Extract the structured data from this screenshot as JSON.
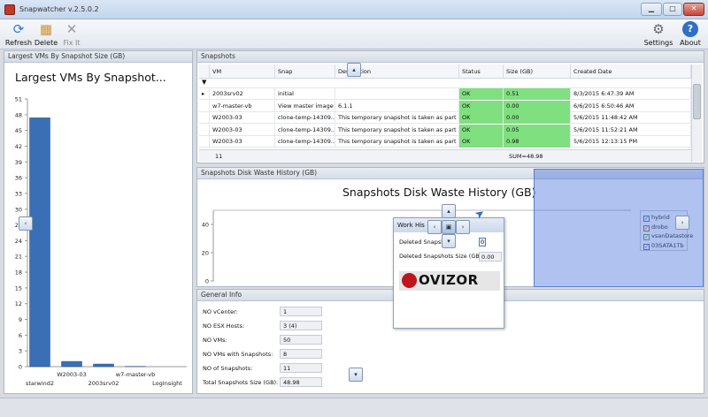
{
  "window": {
    "title": "Snapwatcher v.2.5.0.2"
  },
  "toolbar": {
    "refresh_label": "Refresh",
    "delete_label": "Delete",
    "fixit_label": "Fix It",
    "settings_label": "Settings",
    "about_label": "About"
  },
  "left_panel": {
    "header": "Largest VMs By Snapshot Size (GB)"
  },
  "snapshots_panel": {
    "header": "Snapshots",
    "columns": [
      "VM",
      "Snap",
      "Description",
      "Status",
      "Size (GB)",
      "Created Date"
    ],
    "rows": [
      {
        "vm": "2003srv02",
        "snap": "initial",
        "desc": "",
        "status": "OK",
        "size": "0.51",
        "created": "8/3/2015 6:47:39 AM",
        "selected": true
      },
      {
        "vm": "w7-master-vb",
        "snap": "View master image",
        "desc": "6.1.1",
        "status": "OK",
        "size": "0.00",
        "created": "6/6/2015 6:50:46 AM"
      },
      {
        "vm": "W2003-03",
        "snap": "clone-temp-14309...",
        "desc": "This temporary snapshot is taken as part o...",
        "status": "OK",
        "size": "0.00",
        "created": "5/6/2015 11:48:42 AM"
      },
      {
        "vm": "W2003-03",
        "snap": "clone-temp-14309...",
        "desc": "This temporary snapshot is taken as part o...",
        "status": "OK",
        "size": "0.05",
        "created": "5/6/2015 11:52:21 AM"
      },
      {
        "vm": "W2003-03",
        "snap": "clone-temp-14309...",
        "desc": "This temporary snapshot is taken as part o...",
        "status": "OK",
        "size": "0.98",
        "created": "5/6/2015 12:13:15 PM"
      }
    ],
    "footer_count": "11",
    "footer_sum": "SUM=48.98"
  },
  "waste_panel": {
    "header": "Snapshots Disk Waste History (GB)",
    "chart_title": "Snapshots Disk Waste History (GB)",
    "legend": [
      {
        "name": "hybrid",
        "checked": true
      },
      {
        "name": "drobo",
        "checked": true
      },
      {
        "name": "vsanDatastore",
        "checked": true
      },
      {
        "name": "03SATA1Tb",
        "checked": true
      }
    ]
  },
  "work_window": {
    "title": "Work His",
    "deleted_snaps_label": "Deleted Snapsh",
    "deleted_snaps_value": "0",
    "deleted_size_label": "Deleted Snapshots Size (GB):",
    "deleted_size_value": "0.00",
    "brand": "OVIZOR"
  },
  "info_panel": {
    "header": "General Info",
    "rows": [
      {
        "label": "NO vCenter:",
        "value": "1"
      },
      {
        "label": "NO ESX Hosts:",
        "value": "3 (4)"
      },
      {
        "label": "NO VMs:",
        "value": "50"
      },
      {
        "label": "NO VMs with Snapshots:",
        "value": "8"
      },
      {
        "label": "NO of Snapshots:",
        "value": "11"
      },
      {
        "label": "Total Snapshots Size (GB):",
        "value": "48.98"
      }
    ]
  },
  "colors": {
    "bar": "#3a6fb5",
    "ok": "#7fe07f",
    "dock_overlay": "#5a82dc",
    "legend_hybrid": "#3a6fb5",
    "legend_drobo": "#b84a4a",
    "legend_vsan": "#5e9e4a",
    "legend_sata": "#6b5aa8"
  },
  "chart_data": [
    {
      "type": "bar",
      "title": "Largest VMs By Snapshot...",
      "categories": [
        "starwind2",
        "W2003-03",
        "2003srv02",
        "w7-master-vb",
        "LogInsight"
      ],
      "values": [
        47.4,
        1.0,
        0.5,
        0.05,
        0.0
      ],
      "ylim": [
        0,
        51
      ],
      "yticks": [
        0,
        3,
        6,
        9,
        12,
        15,
        18,
        21,
        24,
        27,
        30,
        33,
        36,
        39,
        42,
        45,
        48,
        51
      ],
      "grid": false
    },
    {
      "type": "line",
      "title": "Snapshots Disk Waste History (GB)",
      "yticks": [
        0,
        20,
        40
      ],
      "ylim": [
        0,
        50
      ],
      "series": [
        {
          "name": "hybrid",
          "values": []
        },
        {
          "name": "drobo",
          "values": []
        },
        {
          "name": "vsanDatastore",
          "values": []
        },
        {
          "name": "03SATA1Tb",
          "values": []
        }
      ],
      "legend": "right"
    }
  ]
}
